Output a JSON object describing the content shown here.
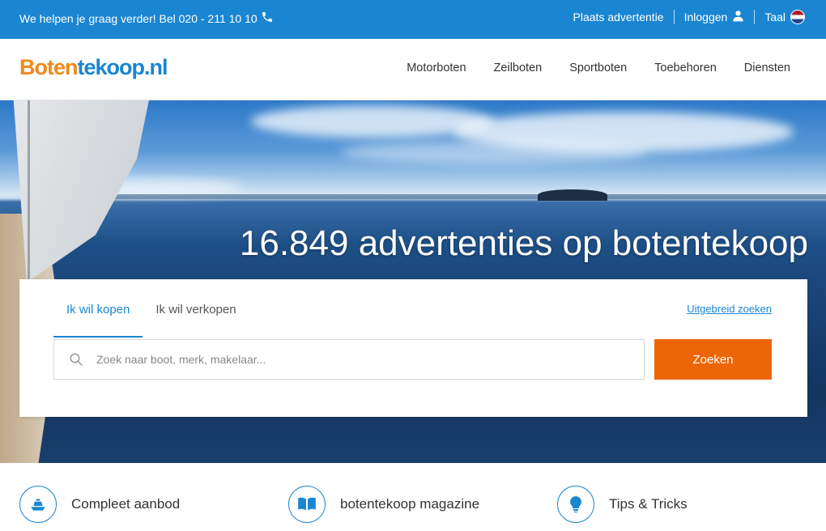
{
  "topbar": {
    "help_text": "We helpen je graag verder! Bel 020 - 211 10 10",
    "place_ad": "Plaats advertentie",
    "login": "Inloggen",
    "language": "Taal"
  },
  "header": {
    "logo_part1": "Boten",
    "logo_part2": "tekoop.nl",
    "nav": [
      "Motorboten",
      "Zeilboten",
      "Sportboten",
      "Toebehoren",
      "Diensten"
    ]
  },
  "hero": {
    "headline": "16.849 advertenties op botentekoop"
  },
  "search": {
    "tab_buy": "Ik wil kopen",
    "tab_sell": "Ik wil verkopen",
    "advanced_link": "Uitgebreid zoeken",
    "placeholder": "Zoek naar boot, merk, makelaar...",
    "button": "Zoeken"
  },
  "features": [
    {
      "label": "Compleet aanbod",
      "icon": "boat-icon"
    },
    {
      "label": "botentekoop magazine",
      "icon": "book-icon"
    },
    {
      "label": "Tips & Tricks",
      "icon": "lightbulb-icon"
    }
  ],
  "colors": {
    "primary": "#1a86d2",
    "accent": "#ec6608",
    "logo_orange": "#f08a1c"
  }
}
